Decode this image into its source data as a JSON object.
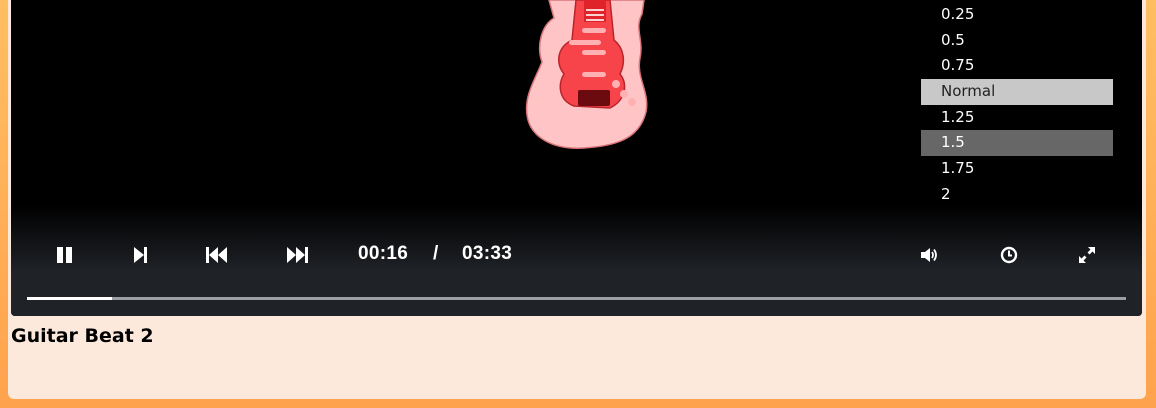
{
  "video": {
    "title": "Guitar Beat 2",
    "current_time": "00:16",
    "separator": "/",
    "duration": "03:33",
    "progress_fraction": 0.077
  },
  "speed_menu": {
    "options": [
      "0.25",
      "0.5",
      "0.75",
      "Normal",
      "1.25",
      "1.5",
      "1.75",
      "2"
    ],
    "highlighted": "Normal",
    "selected": "1.5"
  },
  "icons": {
    "play_pause": "pause-icon",
    "next_frame": "step-forward-icon",
    "rewind": "rewind-icon",
    "fast_forward": "fast-forward-icon",
    "volume": "volume-icon",
    "speed": "clock-icon",
    "fullscreen": "fullscreen-icon"
  },
  "colors": {
    "page_background": "#ffa24e",
    "card_background": "#fde9dc",
    "player_background": "#000000",
    "controls_background": "#1f2227",
    "menu_highlight": "#c8c8c8",
    "menu_selected": "#676767"
  }
}
